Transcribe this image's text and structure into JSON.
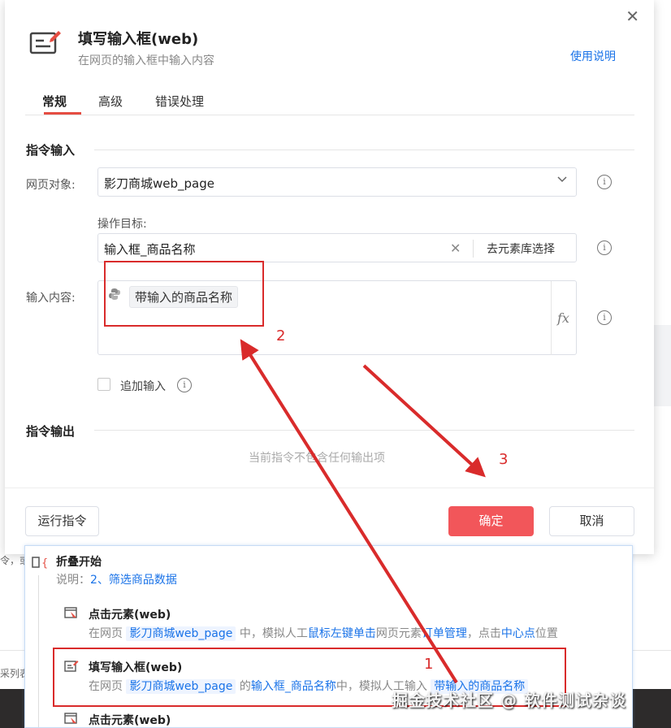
{
  "dialog": {
    "title": "填写输入框(web)",
    "subtitle": "在网页的输入框中输入内容",
    "help_link": "使用说明",
    "close_glyph": "✕"
  },
  "tabs": [
    {
      "label": "常规",
      "active": true
    },
    {
      "label": "高级",
      "active": false
    },
    {
      "label": "错误处理",
      "active": false
    }
  ],
  "input_section": {
    "title": "指令输入",
    "web_object_label": "网页对象:",
    "web_object_value": "影刀商城web_page",
    "target_label": "操作目标:",
    "target_value": "输入框_商品名称",
    "target_pick_button": "去元素库选择",
    "content_label": "输入内容:",
    "content_variable": "带输入的商品名称",
    "fx_label": "fx",
    "append_label": "追加输入"
  },
  "output_section": {
    "title": "指令输出",
    "empty_note": "当前指令不包含任何输出项"
  },
  "footer": {
    "run_button": "运行指令",
    "ok_button": "确定",
    "cancel_button": "取消"
  },
  "flow": {
    "fold": {
      "title": "折叠开始",
      "desc_prefix": "说明：",
      "desc_value": "2、筛选商品数据"
    },
    "rows": [
      {
        "title": "点击元素(web)",
        "desc": [
          "在网页 ",
          "影刀商城web_page",
          " 中，模拟人工",
          "鼠标左键单击",
          "网页元素",
          "订单管理",
          "，点击",
          "中心点",
          "位置"
        ]
      },
      {
        "title": "填写输入框(web)",
        "desc": [
          "在网页 ",
          "影刀商城web_page",
          " 的",
          "输入框_商品名称",
          "中，模拟人工输入 ",
          "带输入的商品名称"
        ]
      },
      {
        "title": "点击元素(web)"
      }
    ]
  },
  "annotations": {
    "label_1": "1",
    "label_2": "2",
    "label_3": "3",
    "color": "#d92b2b"
  },
  "watermark": "掘金技术社区 @ 软件测试杂谈",
  "background": {
    "frag_1": "令，或",
    "frag_2": "采列表"
  },
  "colors": {
    "accent": "#e54d42",
    "primary_button": "#f2565a",
    "link": "#1a73e8"
  }
}
